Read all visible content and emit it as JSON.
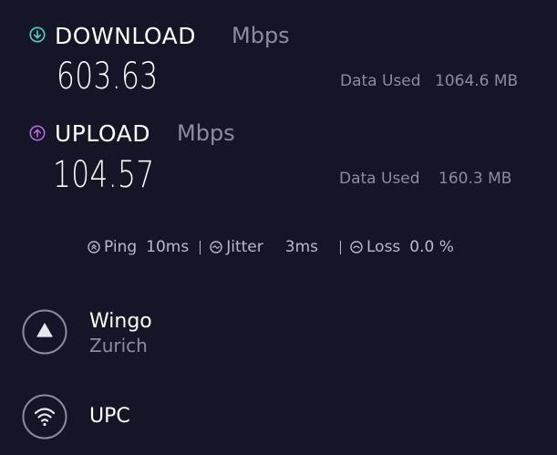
{
  "download": {
    "title": "DOWNLOAD",
    "unit": "Mbps",
    "value": "603.63",
    "data_used_label": "Data Used",
    "data_used_value": "1064.6 MB",
    "icon": "arrow-down-circle-icon",
    "color": "#4fd1c5"
  },
  "upload": {
    "title": "UPLOAD",
    "unit": "Mbps",
    "value": "104.57",
    "data_used_label": "Data Used",
    "data_used_value": "160.3 MB",
    "icon": "arrow-up-circle-icon",
    "color": "#b36ad4"
  },
  "stats": {
    "ping": {
      "label": "Ping",
      "value": "10ms",
      "icon": "ping-icon"
    },
    "jitter": {
      "label": "Jitter",
      "value": "3ms",
      "icon": "jitter-icon"
    },
    "loss": {
      "label": "Loss",
      "value": "0.0 %",
      "icon": "loss-icon"
    }
  },
  "server": {
    "name": "Wingo",
    "location": "Zurich",
    "icon": "server-icon"
  },
  "isp": {
    "name": "UPC",
    "icon": "wifi-icon"
  },
  "colors": {
    "background": "#141526",
    "muted_text": "#8b8d9c",
    "stats_text": "#b9bbc6"
  }
}
